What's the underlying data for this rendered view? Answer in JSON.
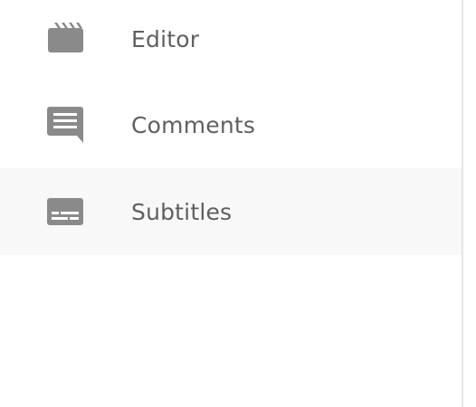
{
  "nav": {
    "items": [
      {
        "label": "Editor",
        "icon": "clapperboard-icon",
        "active": false
      },
      {
        "label": "Comments",
        "icon": "comment-icon",
        "active": false
      },
      {
        "label": "Subtitles",
        "icon": "subtitles-icon",
        "active": true
      }
    ]
  },
  "colors": {
    "icon": "#8a8a8a",
    "text": "#5f5f5f",
    "active_background": "#f8f8f8",
    "divider": "#e6e6e6"
  }
}
